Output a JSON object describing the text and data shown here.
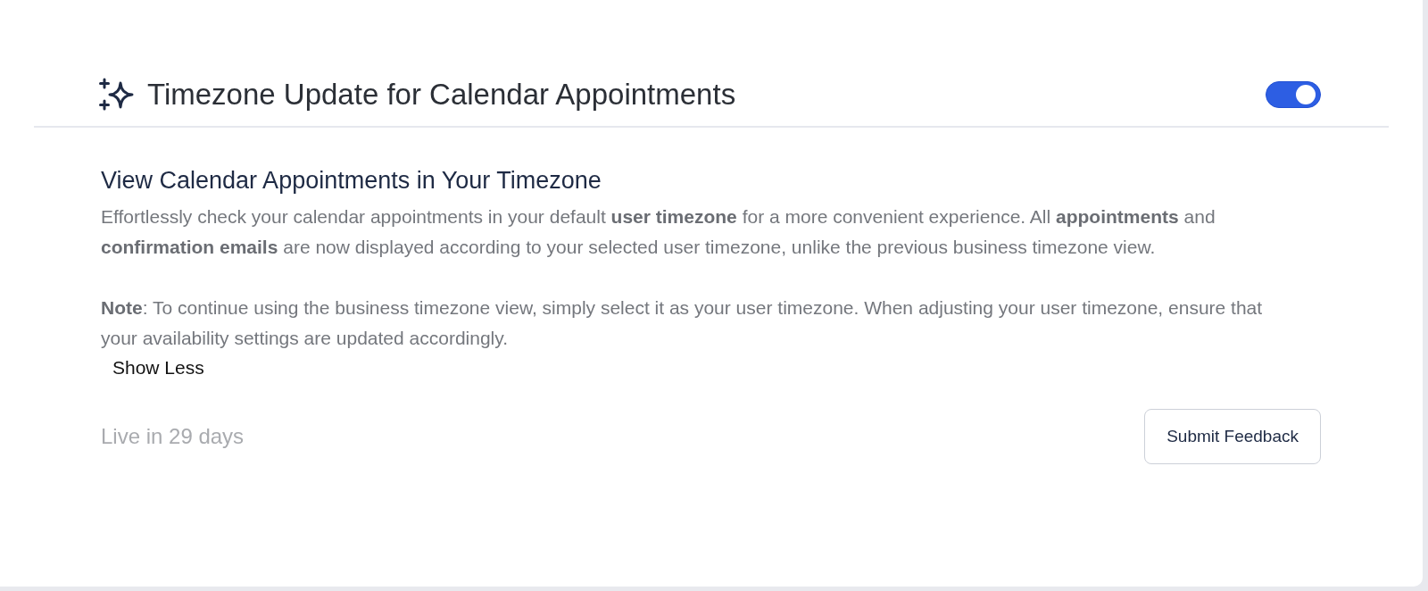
{
  "header": {
    "title": "Timezone Update for Calendar Appointments",
    "toggle": {
      "on": true
    }
  },
  "content": {
    "heading": "View Calendar Appointments in Your Timezone",
    "paragraphs": [
      "Effortlessly check your calendar appointments in your default **user timezone** for a more convenient experience. All **appointments** and **confirmation emails** are now displayed according to your selected user timezone, unlike the previous business timezone view.",
      "**Note**: To continue using the business timezone view, simply select it as your user timezone. When adjusting your user timezone, ensure that your availability settings are updated accordingly."
    ],
    "toggle_link": "Show Less"
  },
  "footer": {
    "status": "Live in 29 days",
    "button": "Submit Feedback"
  }
}
